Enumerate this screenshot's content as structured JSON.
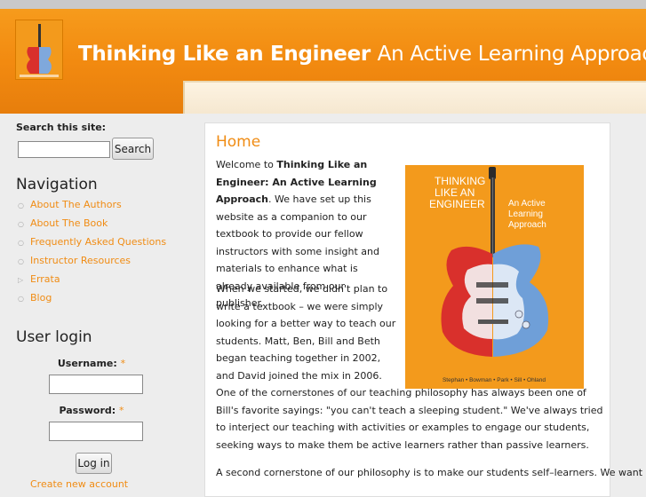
{
  "header": {
    "site_name": "Thinking Like an Engineer",
    "slogan": "An Active Learning Approach",
    "logo_icon": "book-cover-logo"
  },
  "search": {
    "label": "Search this site:",
    "placeholder": "",
    "button_label": "Search"
  },
  "navigation": {
    "title": "Navigation",
    "items": [
      {
        "label": "About The Authors",
        "bullet": "○"
      },
      {
        "label": "About The Book",
        "bullet": "○"
      },
      {
        "label": "Frequently Asked Questions",
        "bullet": "○"
      },
      {
        "label": "Instructor Resources",
        "bullet": "○"
      },
      {
        "label": "Errata",
        "bullet": "▷"
      },
      {
        "label": "Blog",
        "bullet": "○"
      }
    ]
  },
  "login": {
    "title": "User login",
    "username_label": "Username:",
    "password_label": "Password:",
    "required_mark": "*",
    "button_label": "Log in",
    "create_account": "Create new account"
  },
  "main": {
    "title": "Home",
    "p1_intro": "Welcome to ",
    "p1_bold": "Thinking Like an Engineer: An Active Learning Approach",
    "p1_rest": ". We have set up this website as a companion to our textbook to provide our fellow instructors with some insight and materials to enhance what is already available from our publisher.",
    "p2": "When we started, we didn't plan to write a textbook – we were simply looking for a better way to teach our students. Matt, Ben, Bill and Beth began teaching together in 2002, and David joined the mix in 2006. One of the cornerstones of our teaching philosophy has always been one of Bill's favorite sayings: \"you can't teach a sleeping student.\" We've always tried to interject our teaching with activities or examples to engage our students, seeking ways to make them be active learners rather than passive learners.",
    "p3": "A second cornerstone of our philosophy is to make our students self–learners. We want"
  },
  "cover": {
    "title_lines": [
      "THINKING",
      "LIKE AN",
      "ENGINEER"
    ],
    "subtitle_lines": [
      "An Active",
      "Learning",
      "Approach"
    ],
    "authors": "Stephan • Bowman • Park • Sill • Ohland",
    "colors": {
      "bg": "#f39a1c",
      "red": "#d9302c",
      "blue": "#6f9fd8"
    }
  },
  "colors": {
    "accent": "#f08c14",
    "header": "#f28a10"
  }
}
